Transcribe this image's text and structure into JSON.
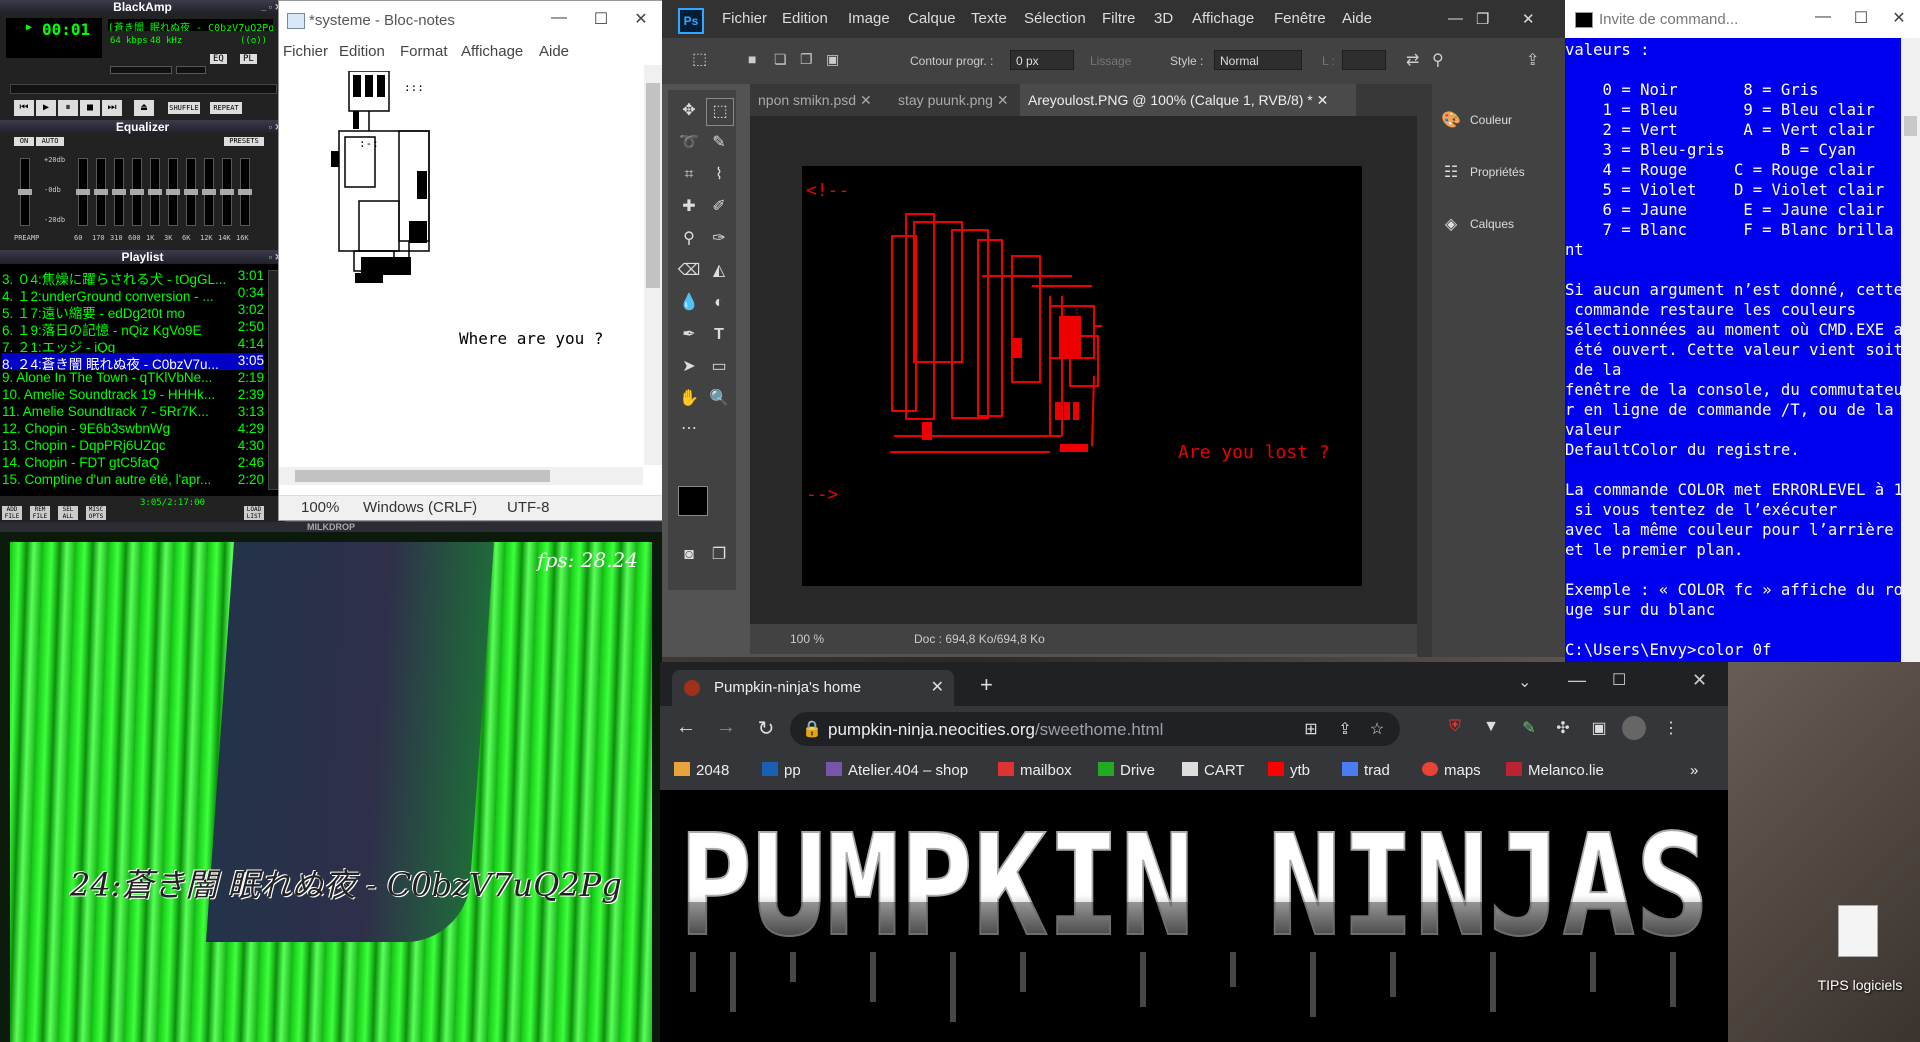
{
  "winamp": {
    "title": "BlackAmp",
    "time": "00:01",
    "track_display": "[蒼き闇 眠れぬ夜 - C0bzV7uQ2Pg",
    "kbps": "64",
    "kbps_label": "kbps",
    "khz": "48",
    "khz_label": "kHz",
    "stereo": "((o))",
    "eq_btn": "EQ",
    "pl_btn": "PL",
    "shuffle": "SHUFFLE",
    "repeat": "REPEAT",
    "equalizer_title": "Equalizer",
    "eq_on": "ON",
    "eq_auto": "AUTO",
    "eq_presets": "PRESETS",
    "eq_preamp": "PREAMP",
    "eq_db_top": "+20db",
    "eq_db_mid": "-0db",
    "eq_db_bot": "-20db",
    "eq_bands": [
      "60",
      "170",
      "310",
      "600",
      "1K",
      "3K",
      "6K",
      "12K",
      "14K",
      "16K"
    ],
    "eq_levels": [
      0.5,
      0.5,
      0.5,
      0.5,
      0.5,
      0.5,
      0.5,
      0.5,
      0.5,
      0.5,
      0.5
    ],
    "playlist_title": "Playlist",
    "playlist": [
      {
        "title": "3. ０4:焦燥に躍らされる犬 - tOgGL...",
        "dur": "3:01"
      },
      {
        "title": "4. １2:underGround conversion - ...",
        "dur": "0:34"
      },
      {
        "title": "5. １7:遠い縮要 - edDg2t0t mo",
        "dur": "3:02"
      },
      {
        "title": "6. １9:落日の記憶 - nQiz KgVo9E",
        "dur": "2:50"
      },
      {
        "title": "7. ２1:エッジ - iQg",
        "dur": "4:14"
      },
      {
        "title": "8. ２4:蒼き闇 眠れぬ夜 - C0bzV7u...",
        "dur": "3:05",
        "selected": true
      },
      {
        "title": "9. Alone In The Town - qTKlVbNe...",
        "dur": "2:19"
      },
      {
        "title": "10. Amelie Soundtrack 19 - HHHk...",
        "dur": "2:39"
      },
      {
        "title": "11. Amelie Soundtrack 7 - 5Rr7K...",
        "dur": "3:13"
      },
      {
        "title": "12. Chopin - 9E6b3swbnWg",
        "dur": "4:29"
      },
      {
        "title": "13. Chopin - DqpPRj6UZqc",
        "dur": "4:30"
      },
      {
        "title": "14. Chopin - FDT gtC5faQ",
        "dur": "2:46"
      },
      {
        "title": "15. Comptine d'un autre été, l'apr...",
        "dur": "2:20"
      }
    ],
    "pl_buttons": [
      "ADD FILE",
      "REM FILE",
      "SEL ALL",
      "MISC OPTS",
      "LOAD LIST"
    ],
    "pl_time": "3:05/2:17:00"
  },
  "milkdrop": {
    "bar_title": "MILKDROP",
    "fps": "fps: 28.24",
    "song": "24:蒼き闇 眠れぬ夜 - C0bzV7uQ2Pg"
  },
  "notepad": {
    "title": "*systeme - Bloc-notes",
    "menu": [
      "Fichier",
      "Edition",
      "Format",
      "Affichage",
      "Aide"
    ],
    "text": "Where are you ?",
    "art_dots": ":::",
    "art_face": ":-:",
    "status_zoom": "100%",
    "status_eol": "Windows (CRLF)",
    "status_enc": "UTF-8"
  },
  "photoshop": {
    "logo": "Ps",
    "menu": [
      "Fichier",
      "Edition",
      "Image",
      "Calque",
      "Texte",
      "Sélection",
      "Filtre",
      "3D",
      "Affichage",
      "Fenêtre",
      "Aide"
    ],
    "opt_contour": "Contour progr. :",
    "opt_contour_val": "0 px",
    "opt_lissage": "Lissage",
    "opt_style": "Style :",
    "opt_style_val": "Normal",
    "opt_l": "L :",
    "tabs": [
      "npon smikn.psd",
      "stay puunk.png",
      "Areyoulost.PNG @ 100% (Calque 1, RVB/8) *"
    ],
    "canvas_open": "<!--",
    "canvas_close": "-->",
    "canvas_text": "Are you lost ?",
    "canvas_face": ": :",
    "zoom": "100 %",
    "doc": "Doc : 694,8 Ko/694,8 Ko",
    "panels": [
      "Couleur",
      "Propriétés",
      "Calques"
    ]
  },
  "cmd": {
    "title": "Invite de command...",
    "lines": [
      "valeurs :",
      "",
      "    0 = Noir       8 = Gris",
      "    1 = Bleu       9 = Bleu clair",
      "    2 = Vert       A = Vert clair",
      "    3 = Bleu-gris      B = Cyan",
      "    4 = Rouge     C = Rouge clair",
      "    5 = Violet    D = Violet clair",
      "    6 = Jaune      E = Jaune clair",
      "    7 = Blanc      F = Blanc brilla",
      "nt",
      "",
      "Si aucun argument n’est donné, cette",
      " commande restaure les couleurs",
      "sélectionnées au moment où CMD.EXE a",
      " été ouvert. Cette valeur vient soit",
      " de la",
      "fenêtre de la console, du commutateu",
      "r en ligne de commande /T, ou de la",
      "valeur",
      "DefaultColor du registre.",
      "",
      "La commande COLOR met ERRORLEVEL à 1",
      " si vous tentez de l’exécuter",
      "avec la même couleur pour l’arrière",
      "et le premier plan.",
      "",
      "Exemple : « COLOR fc » affiche du ro",
      "uge sur du blanc",
      "",
      "C:\\Users\\Envy>color 0f"
    ]
  },
  "chrome": {
    "tab_title": "Pumpkin-ninja's home",
    "url_domain": "pumpkin-ninja.neocities.org",
    "url_path": "/sweethome.html",
    "bookmarks": [
      "2048",
      "pp",
      "Atelier.404 – shop",
      "mailbox",
      "Drive",
      "CART",
      "ytb",
      "trad",
      "maps",
      "Melanco.lie"
    ],
    "banner": "PUMPKIN NINJAS"
  },
  "desktop": {
    "icon_label": "TIPS logiciels"
  }
}
